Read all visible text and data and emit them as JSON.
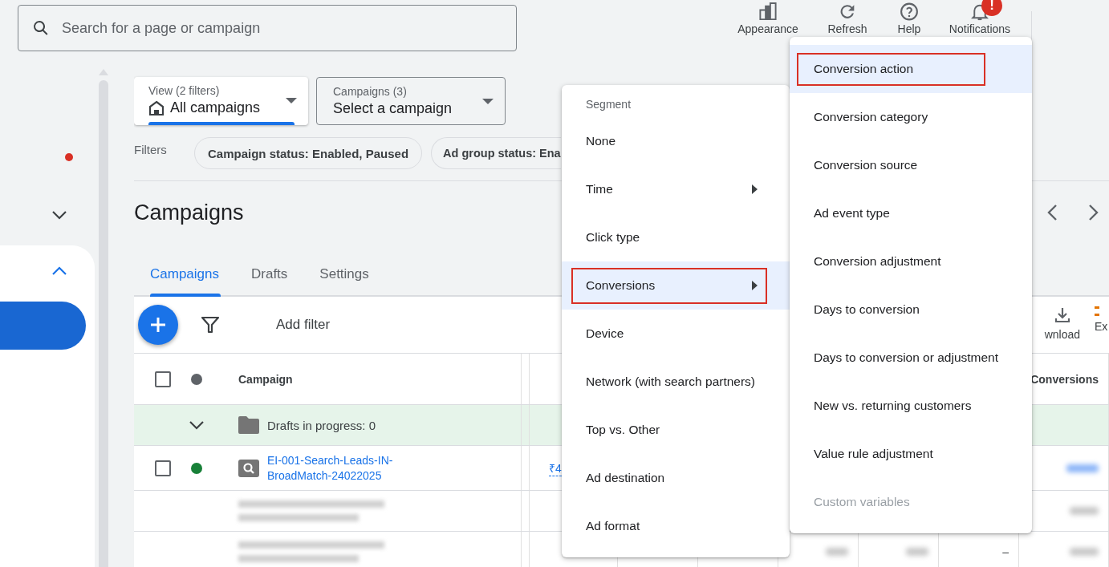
{
  "search": {
    "placeholder": "Search for a page or campaign"
  },
  "toolbar": [
    {
      "label": "Appearance"
    },
    {
      "label": "Refresh"
    },
    {
      "label": "Help"
    },
    {
      "label": "Notifications",
      "badge": "!"
    }
  ],
  "sidebar": {
    "sections": [
      {
        "expanded": false
      },
      {
        "expanded": true
      }
    ]
  },
  "view_selector": {
    "label": "View (2 filters)",
    "value": "All campaigns"
  },
  "campaign_selector": {
    "label": "Campaigns (3)",
    "value": "Select a campaign"
  },
  "filters": {
    "label": "Filters",
    "chips": [
      "Campaign status: Enabled, Paused",
      "Ad group status: Ena"
    ]
  },
  "page_title": "Campaigns",
  "tabs": [
    {
      "label": "Campaigns",
      "selected": true
    },
    {
      "label": "Drafts",
      "selected": false
    },
    {
      "label": "Settings",
      "selected": false
    }
  ],
  "table_toolbar": {
    "add_filter": "Add filter",
    "actions": [
      {
        "label": "wnload"
      },
      {
        "label": "Ex"
      }
    ]
  },
  "table": {
    "select_all": {
      "checked": false
    },
    "columns": [
      {
        "label": "Campaign"
      },
      {
        "label": "Conversions"
      }
    ],
    "rows": [
      {
        "kind": "group",
        "expanded": false,
        "label": "Drafts in progress: 0"
      },
      {
        "kind": "campaign",
        "checked": false,
        "color": "#188038",
        "name": "EI-001-Search-Leads-IN-BroadMatch-24022025",
        "budget": "₹4"
      },
      {
        "kind": "redacted"
      },
      {
        "kind": "redacted",
        "column_7": "–"
      }
    ]
  },
  "segment_menu": {
    "header": "Segment",
    "items": [
      {
        "label": "None",
        "submenu": false,
        "selected": false,
        "outlined": false
      },
      {
        "label": "Time",
        "submenu": true,
        "selected": false,
        "outlined": false
      },
      {
        "label": "Click type",
        "submenu": false,
        "selected": false,
        "outlined": false
      },
      {
        "label": "Conversions",
        "submenu": true,
        "selected": true,
        "outlined": true
      },
      {
        "label": "Device",
        "submenu": false,
        "selected": false,
        "outlined": false
      },
      {
        "label": "Network (with search partners)",
        "submenu": false,
        "selected": false,
        "outlined": false
      },
      {
        "label": "Top vs. Other",
        "submenu": false,
        "selected": false,
        "outlined": false
      },
      {
        "label": "Ad destination",
        "submenu": false,
        "selected": false,
        "outlined": false
      },
      {
        "label": "Ad format",
        "submenu": false,
        "selected": false,
        "outlined": false
      }
    ]
  },
  "submenu": {
    "items": [
      {
        "label": "Conversion action",
        "selected": true,
        "outlined": true,
        "disabled": false
      },
      {
        "label": "Conversion category",
        "selected": false,
        "outlined": false,
        "disabled": false
      },
      {
        "label": "Conversion source",
        "selected": false,
        "outlined": false,
        "disabled": false
      },
      {
        "label": "Ad event type",
        "selected": false,
        "outlined": false,
        "disabled": false
      },
      {
        "label": "Conversion adjustment",
        "selected": false,
        "outlined": false,
        "disabled": false
      },
      {
        "label": "Days to conversion",
        "selected": false,
        "outlined": false,
        "disabled": false
      },
      {
        "label": "Days to conversion or adjustment",
        "selected": false,
        "outlined": false,
        "disabled": false
      },
      {
        "label": "New vs. returning customers",
        "selected": false,
        "outlined": false,
        "disabled": false
      },
      {
        "label": "Value rule adjustment",
        "selected": false,
        "outlined": false,
        "disabled": false
      },
      {
        "label": "Custom variables",
        "selected": false,
        "outlined": false,
        "disabled": true
      }
    ]
  }
}
